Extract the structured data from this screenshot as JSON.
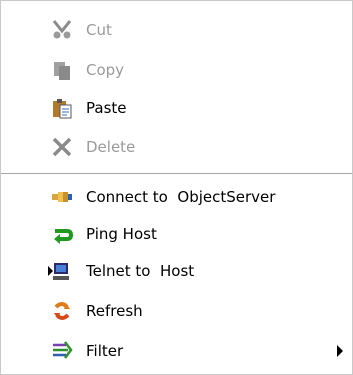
{
  "menu": {
    "items": [
      {
        "label": "Cut",
        "icon": "scissors-icon",
        "enabled": false
      },
      {
        "label": "Copy",
        "icon": "copy-icon",
        "enabled": false
      },
      {
        "label": "Paste",
        "icon": "clipboard-paste-icon",
        "enabled": true
      },
      {
        "label": "Delete",
        "icon": "delete-x-icon",
        "enabled": false
      },
      {
        "label": "Connect to  ObjectServer",
        "icon": "connect-plug-icon",
        "enabled": true
      },
      {
        "label": "Ping Host",
        "icon": "ping-arrow-icon",
        "enabled": true
      },
      {
        "label": "Telnet to  Host",
        "icon": "terminal-icon",
        "enabled": true
      },
      {
        "label": "Refresh",
        "icon": "refresh-icon",
        "enabled": true
      },
      {
        "label": "Filter",
        "icon": "filter-icon",
        "enabled": true,
        "has_submenu": true
      }
    ]
  },
  "colors": {
    "disabled_text": "#9a9a9a",
    "separator": "#a6a6a6",
    "border": "#c9c9c9"
  }
}
